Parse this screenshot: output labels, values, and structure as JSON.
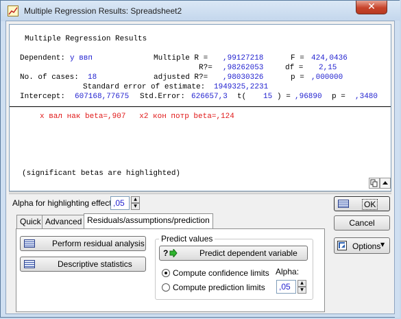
{
  "window": {
    "title": "Multiple Regression Results: Spreadsheet2",
    "close_glyph": "✕"
  },
  "results": {
    "heading": "Multiple Regression Results",
    "dependent_label": "Dependent:",
    "dependent_value": "y ввп",
    "multiple_r_label": "Multiple R =",
    "multiple_r_value": ",99127218",
    "f_label": "F =",
    "f_value": "424,0436",
    "r2_label": "R?=",
    "r2_value": ",98262053",
    "df_label": "df =",
    "df_value": "2,15",
    "cases_label": "No. of cases:",
    "cases_value": "18",
    "adj_r2_label": "adjusted R?=",
    "adj_r2_value": ",98030326",
    "p_label": "p =",
    "p_value": ",000000",
    "stderr_label": "Standard error of estimate:",
    "stderr_value": "1949325,2231",
    "intercept_label": "Intercept:",
    "intercept_value": "607168,77675",
    "intercept_stderr_label": "Std.Error:",
    "intercept_stderr_value": "626657,3",
    "t_label": "t(",
    "t_df": "15",
    "t_close": ") =",
    "t_value": ",96890",
    "t_p_label": "p =",
    "t_p_value": ",3480",
    "betas": "x вал нак beta=,907   x2 кон потр beta=,124",
    "note": "(significant betas are highlighted)"
  },
  "controls": {
    "alpha_label": "Alpha for highlighting effects:",
    "alpha_value": ",05",
    "ok_label": "OK",
    "cancel_label": "Cancel",
    "options_label": "Options",
    "tabs": [
      "Quick",
      "Advanced",
      "Residuals/assumptions/prediction"
    ],
    "active_tab": 2,
    "residual_button": "Perform residual analysis",
    "descriptive_button": "Descriptive statistics",
    "predict_group_title": "Predict values",
    "predict_button": "Predict dependent variable",
    "predict_prefix": "?",
    "confidence_label": "Compute confidence limits",
    "prediction_label": "Compute prediction limits",
    "confidence_selected": true,
    "alpha2_label": "Alpha:",
    "alpha2_value": ",05"
  },
  "icons": [
    "app-icon",
    "close-icon",
    "table-icon",
    "arrow-up-icon",
    "arrow-down-icon",
    "predict-arrow-icon",
    "options-icon",
    "copy-icon"
  ],
  "colors": {
    "highlight_red": "#e01818",
    "value_blue": "#1f1fcf",
    "frame_blue": "#cfdff1"
  }
}
